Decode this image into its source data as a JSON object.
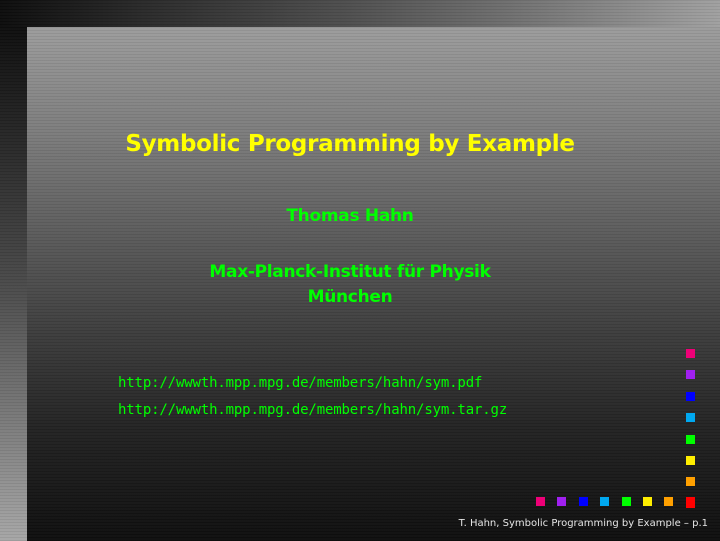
{
  "slide": {
    "title": "Symbolic Programming by Example",
    "author": "Thomas Hahn",
    "institute": "Max-Planck-Institut für Physik",
    "city": "München",
    "links": [
      "http://wwwth.mpp.mpg.de/members/hahn/sym.pdf",
      "http://wwwth.mpp.mpg.de/members/hahn/sym.tar.gz"
    ],
    "footer": "T. Hahn, Symbolic Programming by Example – p.1"
  },
  "colors": {
    "title": "#ffff00",
    "text": "#00ff00",
    "footer": "#e6e6e6"
  },
  "navigation": {
    "buttons": [
      {
        "name": "first-page-button",
        "color": "#ee0077"
      },
      {
        "name": "previous-section-button",
        "color": "#a020f0"
      },
      {
        "name": "previous-page-button",
        "color": "#0000ff"
      },
      {
        "name": "back-button",
        "color": "#00a8f0"
      },
      {
        "name": "search-button",
        "color": "#00ff00"
      },
      {
        "name": "forward-button",
        "color": "#ffee00"
      },
      {
        "name": "next-page-button",
        "color": "#ffa000"
      },
      {
        "name": "last-page-button",
        "color": "#ff0000"
      }
    ]
  }
}
